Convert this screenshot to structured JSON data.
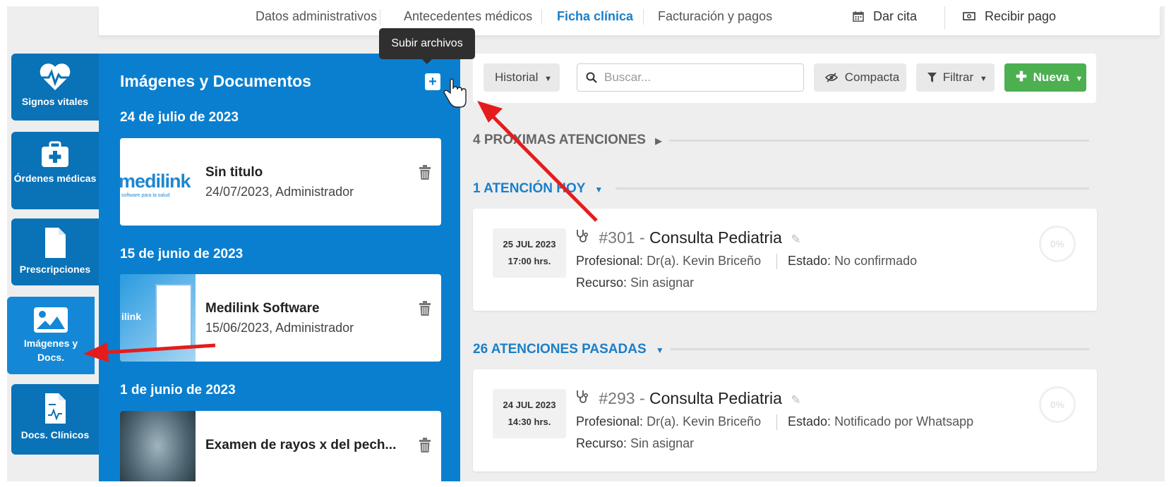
{
  "tabs": [
    {
      "label": "Datos administrativos",
      "active": false
    },
    {
      "label": "Antecedentes médicos",
      "active": false
    },
    {
      "label": "Ficha clínica",
      "active": true
    },
    {
      "label": "Facturación y pagos",
      "active": false
    }
  ],
  "top_actions": {
    "dar_cita": "Dar cita",
    "recibir_pago": "Recibir pago"
  },
  "nav": {
    "items": [
      {
        "label": "Signos vitales",
        "icon": "heartbeat-icon"
      },
      {
        "label": "Órdenes médicas",
        "icon": "medkit-icon"
      },
      {
        "label": "Prescripciones",
        "icon": "file-icon"
      },
      {
        "label": "Imágenes y Docs.",
        "icon": "image-icon",
        "active": true
      },
      {
        "label": "Docs. Clínicos",
        "icon": "clinical-doc-icon"
      }
    ]
  },
  "panel": {
    "title": "Imágenes y Documentos",
    "upload_tooltip": "Subir archivos",
    "groups": [
      {
        "date": "24 de julio de 2023",
        "docs": [
          {
            "title": "Sin titulo",
            "meta": "24/07/2023, Administrador",
            "thumb_text": "medilink",
            "thumb_sub": "software para la salud"
          }
        ]
      },
      {
        "date": "15 de junio de 2023",
        "docs": [
          {
            "title": "Medilink Software",
            "meta": "15/06/2023, Administrador",
            "thumb_text": "ilink"
          }
        ]
      },
      {
        "date": "1 de junio de 2023",
        "docs": [
          {
            "title": "Examen de rayos x del pech...",
            "meta": ""
          }
        ]
      }
    ]
  },
  "toolbar": {
    "historial": "Historial",
    "search_placeholder": "Buscar...",
    "compacta": "Compacta",
    "filtrar": "Filtrar",
    "nueva": "Nueva"
  },
  "sections": {
    "proximas": "4 PRÓXIMAS ATENCIONES",
    "hoy": "1 ATENCIÓN HOY",
    "pasadas": "26 ATENCIONES PASADAS"
  },
  "appointments": [
    {
      "day": "25 JUL 2023",
      "time": "17:00 hrs.",
      "number": "#301",
      "separator": "-",
      "title": "Consulta Pediatria",
      "profesional_label": "Profesional:",
      "profesional": "Dr(a). Kevin Briceño",
      "estado_label": "Estado:",
      "estado": "No confirmado",
      "recurso_label": "Recurso:",
      "recurso": "Sin asignar",
      "progress": "0%"
    },
    {
      "day": "24 JUL 2023",
      "time": "14:30 hrs.",
      "number": "#293",
      "separator": "-",
      "title": "Consulta Pediatria",
      "profesional_label": "Profesional:",
      "profesional": "Dr(a). Kevin Briceño",
      "estado_label": "Estado:",
      "estado": "Notificado por Whatsapp",
      "recurso_label": "Recurso:",
      "recurso": "Sin asignar",
      "progress": "0%"
    }
  ],
  "colors": {
    "panel_blue": "#0a7fd0",
    "nav_blue": "#0a72b7",
    "accent_blue": "#1a7fc9",
    "green": "#4caf50",
    "arrow_red": "#e51c1c"
  }
}
